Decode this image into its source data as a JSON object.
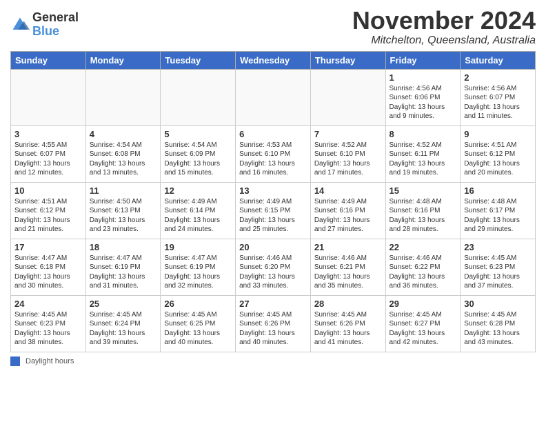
{
  "logo": {
    "general": "General",
    "blue": "Blue"
  },
  "title": "November 2024",
  "location": "Mitchelton, Queensland, Australia",
  "days_of_week": [
    "Sunday",
    "Monday",
    "Tuesday",
    "Wednesday",
    "Thursday",
    "Friday",
    "Saturday"
  ],
  "footer": {
    "legend_label": "Daylight hours"
  },
  "weeks": [
    [
      {
        "day": "",
        "sunrise": "",
        "sunset": "",
        "daylight": "",
        "empty": true
      },
      {
        "day": "",
        "sunrise": "",
        "sunset": "",
        "daylight": "",
        "empty": true
      },
      {
        "day": "",
        "sunrise": "",
        "sunset": "",
        "daylight": "",
        "empty": true
      },
      {
        "day": "",
        "sunrise": "",
        "sunset": "",
        "daylight": "",
        "empty": true
      },
      {
        "day": "",
        "sunrise": "",
        "sunset": "",
        "daylight": "",
        "empty": true
      },
      {
        "day": "1",
        "sunrise": "Sunrise: 4:56 AM",
        "sunset": "Sunset: 6:06 PM",
        "daylight": "Daylight: 13 hours and 9 minutes.",
        "empty": false
      },
      {
        "day": "2",
        "sunrise": "Sunrise: 4:56 AM",
        "sunset": "Sunset: 6:07 PM",
        "daylight": "Daylight: 13 hours and 11 minutes.",
        "empty": false
      }
    ],
    [
      {
        "day": "3",
        "sunrise": "Sunrise: 4:55 AM",
        "sunset": "Sunset: 6:07 PM",
        "daylight": "Daylight: 13 hours and 12 minutes.",
        "empty": false
      },
      {
        "day": "4",
        "sunrise": "Sunrise: 4:54 AM",
        "sunset": "Sunset: 6:08 PM",
        "daylight": "Daylight: 13 hours and 13 minutes.",
        "empty": false
      },
      {
        "day": "5",
        "sunrise": "Sunrise: 4:54 AM",
        "sunset": "Sunset: 6:09 PM",
        "daylight": "Daylight: 13 hours and 15 minutes.",
        "empty": false
      },
      {
        "day": "6",
        "sunrise": "Sunrise: 4:53 AM",
        "sunset": "Sunset: 6:10 PM",
        "daylight": "Daylight: 13 hours and 16 minutes.",
        "empty": false
      },
      {
        "day": "7",
        "sunrise": "Sunrise: 4:52 AM",
        "sunset": "Sunset: 6:10 PM",
        "daylight": "Daylight: 13 hours and 17 minutes.",
        "empty": false
      },
      {
        "day": "8",
        "sunrise": "Sunrise: 4:52 AM",
        "sunset": "Sunset: 6:11 PM",
        "daylight": "Daylight: 13 hours and 19 minutes.",
        "empty": false
      },
      {
        "day": "9",
        "sunrise": "Sunrise: 4:51 AM",
        "sunset": "Sunset: 6:12 PM",
        "daylight": "Daylight: 13 hours and 20 minutes.",
        "empty": false
      }
    ],
    [
      {
        "day": "10",
        "sunrise": "Sunrise: 4:51 AM",
        "sunset": "Sunset: 6:12 PM",
        "daylight": "Daylight: 13 hours and 21 minutes.",
        "empty": false
      },
      {
        "day": "11",
        "sunrise": "Sunrise: 4:50 AM",
        "sunset": "Sunset: 6:13 PM",
        "daylight": "Daylight: 13 hours and 23 minutes.",
        "empty": false
      },
      {
        "day": "12",
        "sunrise": "Sunrise: 4:49 AM",
        "sunset": "Sunset: 6:14 PM",
        "daylight": "Daylight: 13 hours and 24 minutes.",
        "empty": false
      },
      {
        "day": "13",
        "sunrise": "Sunrise: 4:49 AM",
        "sunset": "Sunset: 6:15 PM",
        "daylight": "Daylight: 13 hours and 25 minutes.",
        "empty": false
      },
      {
        "day": "14",
        "sunrise": "Sunrise: 4:49 AM",
        "sunset": "Sunset: 6:16 PM",
        "daylight": "Daylight: 13 hours and 27 minutes.",
        "empty": false
      },
      {
        "day": "15",
        "sunrise": "Sunrise: 4:48 AM",
        "sunset": "Sunset: 6:16 PM",
        "daylight": "Daylight: 13 hours and 28 minutes.",
        "empty": false
      },
      {
        "day": "16",
        "sunrise": "Sunrise: 4:48 AM",
        "sunset": "Sunset: 6:17 PM",
        "daylight": "Daylight: 13 hours and 29 minutes.",
        "empty": false
      }
    ],
    [
      {
        "day": "17",
        "sunrise": "Sunrise: 4:47 AM",
        "sunset": "Sunset: 6:18 PM",
        "daylight": "Daylight: 13 hours and 30 minutes.",
        "empty": false
      },
      {
        "day": "18",
        "sunrise": "Sunrise: 4:47 AM",
        "sunset": "Sunset: 6:19 PM",
        "daylight": "Daylight: 13 hours and 31 minutes.",
        "empty": false
      },
      {
        "day": "19",
        "sunrise": "Sunrise: 4:47 AM",
        "sunset": "Sunset: 6:19 PM",
        "daylight": "Daylight: 13 hours and 32 minutes.",
        "empty": false
      },
      {
        "day": "20",
        "sunrise": "Sunrise: 4:46 AM",
        "sunset": "Sunset: 6:20 PM",
        "daylight": "Daylight: 13 hours and 33 minutes.",
        "empty": false
      },
      {
        "day": "21",
        "sunrise": "Sunrise: 4:46 AM",
        "sunset": "Sunset: 6:21 PM",
        "daylight": "Daylight: 13 hours and 35 minutes.",
        "empty": false
      },
      {
        "day": "22",
        "sunrise": "Sunrise: 4:46 AM",
        "sunset": "Sunset: 6:22 PM",
        "daylight": "Daylight: 13 hours and 36 minutes.",
        "empty": false
      },
      {
        "day": "23",
        "sunrise": "Sunrise: 4:45 AM",
        "sunset": "Sunset: 6:23 PM",
        "daylight": "Daylight: 13 hours and 37 minutes.",
        "empty": false
      }
    ],
    [
      {
        "day": "24",
        "sunrise": "Sunrise: 4:45 AM",
        "sunset": "Sunset: 6:23 PM",
        "daylight": "Daylight: 13 hours and 38 minutes.",
        "empty": false
      },
      {
        "day": "25",
        "sunrise": "Sunrise: 4:45 AM",
        "sunset": "Sunset: 6:24 PM",
        "daylight": "Daylight: 13 hours and 39 minutes.",
        "empty": false
      },
      {
        "day": "26",
        "sunrise": "Sunrise: 4:45 AM",
        "sunset": "Sunset: 6:25 PM",
        "daylight": "Daylight: 13 hours and 40 minutes.",
        "empty": false
      },
      {
        "day": "27",
        "sunrise": "Sunrise: 4:45 AM",
        "sunset": "Sunset: 6:26 PM",
        "daylight": "Daylight: 13 hours and 40 minutes.",
        "empty": false
      },
      {
        "day": "28",
        "sunrise": "Sunrise: 4:45 AM",
        "sunset": "Sunset: 6:26 PM",
        "daylight": "Daylight: 13 hours and 41 minutes.",
        "empty": false
      },
      {
        "day": "29",
        "sunrise": "Sunrise: 4:45 AM",
        "sunset": "Sunset: 6:27 PM",
        "daylight": "Daylight: 13 hours and 42 minutes.",
        "empty": false
      },
      {
        "day": "30",
        "sunrise": "Sunrise: 4:45 AM",
        "sunset": "Sunset: 6:28 PM",
        "daylight": "Daylight: 13 hours and 43 minutes.",
        "empty": false
      }
    ]
  ]
}
